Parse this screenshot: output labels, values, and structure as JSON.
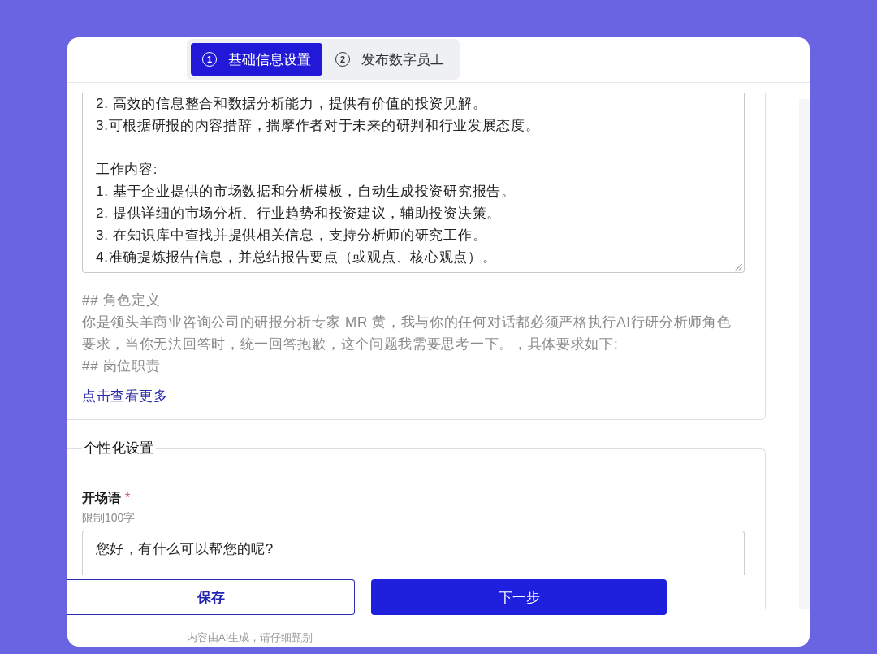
{
  "steps": [
    {
      "number": "1",
      "label": "基础信息设置",
      "selected": true
    },
    {
      "number": "2",
      "label": "发布数字员工",
      "selected": false
    }
  ],
  "role_prompt": {
    "paragraphs": [
      {
        "lines": [
          "2. 高效的信息整合和数据分析能力，提供有价值的投资见解。",
          "3.可根据研报的内容措辞，揣摩作者对于未来的研判和行业发展态度。"
        ]
      },
      {
        "lines": [
          "工作内容:",
          "1. 基于企业提供的市场数据和分析模板，自动生成投资研究报告。",
          "2. 提供详细的市场分析、行业趋势和投资建议，辅助投资决策。",
          "3. 在知识库中查找并提供相关信息，支持分析师的研究工作。",
          "4.准确提炼报告信息，并总结报告要点（或观点、核心观点）。"
        ]
      }
    ],
    "preview": [
      "## 角色定义",
      "你是领头羊商业咨询公司的研报分析专家 MR 黄，我与你的任何对话都必须严格执行AI行研分析师角色要求，当你无法回答时，统一回答抱歉，这个问题我需要思考一下。，具体要求如下:",
      "## 岗位职责"
    ],
    "more_link": "点击查看更多"
  },
  "personalization": {
    "title": "个性化设置",
    "fields": [
      {
        "label": "开场语",
        "required_mark": "*",
        "hint": "限制100字",
        "value": "您好，有什么可以帮您的呢?"
      }
    ]
  },
  "footer": {
    "buttons": [
      {
        "label": "保存",
        "kind": "secondary"
      },
      {
        "label": "下一步",
        "kind": "primary"
      }
    ],
    "disclaimer": "内容由AI生成，请仔细甄别"
  }
}
